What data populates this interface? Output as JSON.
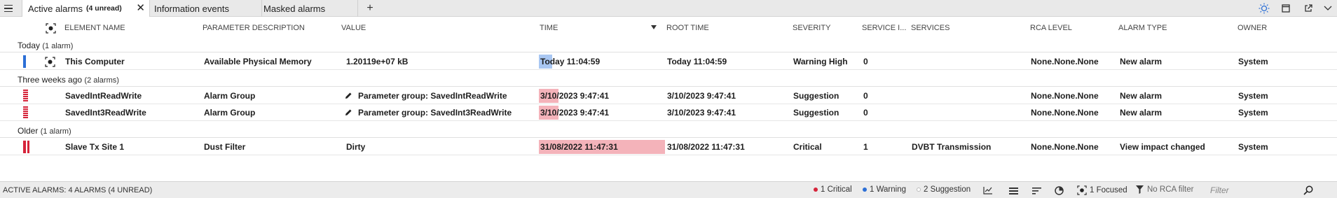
{
  "tabs": [
    {
      "label": "Active alarms",
      "unread": "(4 unread)",
      "close": "✕"
    },
    {
      "label": "Information events"
    },
    {
      "label": "Masked alarms"
    }
  ],
  "add_tab": "+",
  "columns": {
    "element_name": "ELEMENT NAME",
    "parameter_description": "PARAMETER DESCRIPTION",
    "value": "VALUE",
    "time": "TIME",
    "root_time": "ROOT TIME",
    "severity": "SEVERITY",
    "service_impact": "SERVICE I...",
    "services": "SERVICES",
    "rca_level": "RCA LEVEL",
    "alarm_type": "ALARM TYPE",
    "owner": "OWNER"
  },
  "groups": [
    {
      "label": "Today",
      "count": "(1 alarm)"
    },
    {
      "label": "Three weeks ago",
      "count": "(2 alarms)"
    },
    {
      "label": "Older",
      "count": "(1 alarm)"
    }
  ],
  "rows": [
    {
      "element": "This Computer",
      "parameter": "Available Physical Memory",
      "value": "1.20119e+07 kB",
      "time": "Today 11:04:59",
      "root_time": "Today 11:04:59",
      "severity": "Warning High",
      "service_impact": "0",
      "services": "",
      "rca": "None.None.None",
      "alarm_type": "New alarm",
      "owner": "System"
    },
    {
      "element": "SavedIntReadWrite",
      "parameter": "Alarm Group",
      "value": "Parameter group: SavedIntReadWrite",
      "time": "3/10/2023 9:47:41",
      "root_time": "3/10/2023 9:47:41",
      "severity": "Suggestion",
      "service_impact": "0",
      "services": "",
      "rca": "None.None.None",
      "alarm_type": "New alarm",
      "owner": "System"
    },
    {
      "element": "SavedInt3ReadWrite",
      "parameter": "Alarm Group",
      "value": "Parameter group: SavedInt3ReadWrite",
      "time": "3/10/2023 9:47:41",
      "root_time": "3/10/2023 9:47:41",
      "severity": "Suggestion",
      "service_impact": "0",
      "services": "",
      "rca": "None.None.None",
      "alarm_type": "New alarm",
      "owner": "System"
    },
    {
      "element": "Slave Tx Site 1",
      "parameter": "Dust Filter",
      "value": "Dirty",
      "time": "31/08/2022 11:47:31",
      "root_time": "31/08/2022 11:47:31",
      "severity": "Critical",
      "service_impact": "1",
      "services": "DVBT Transmission",
      "rca": "None.None.None",
      "alarm_type": "View impact changed",
      "owner": "System"
    }
  ],
  "status": {
    "summary": "ACTIVE ALARMS: 4 ALARMS (4 UNREAD)",
    "critical": "1 Critical",
    "warning": "1 Warning",
    "suggestion": "2 Suggestion",
    "focused": "1 Focused",
    "rca_filter": "No RCA filter",
    "filter_placeholder": "Filter"
  },
  "colors": {
    "critical": "#d6243a",
    "warning": "#2c6fd6",
    "suggestion": "#ffffff",
    "time_highlight_blue": "#a9c7f2",
    "time_highlight_pink": "#f4b3ba"
  }
}
